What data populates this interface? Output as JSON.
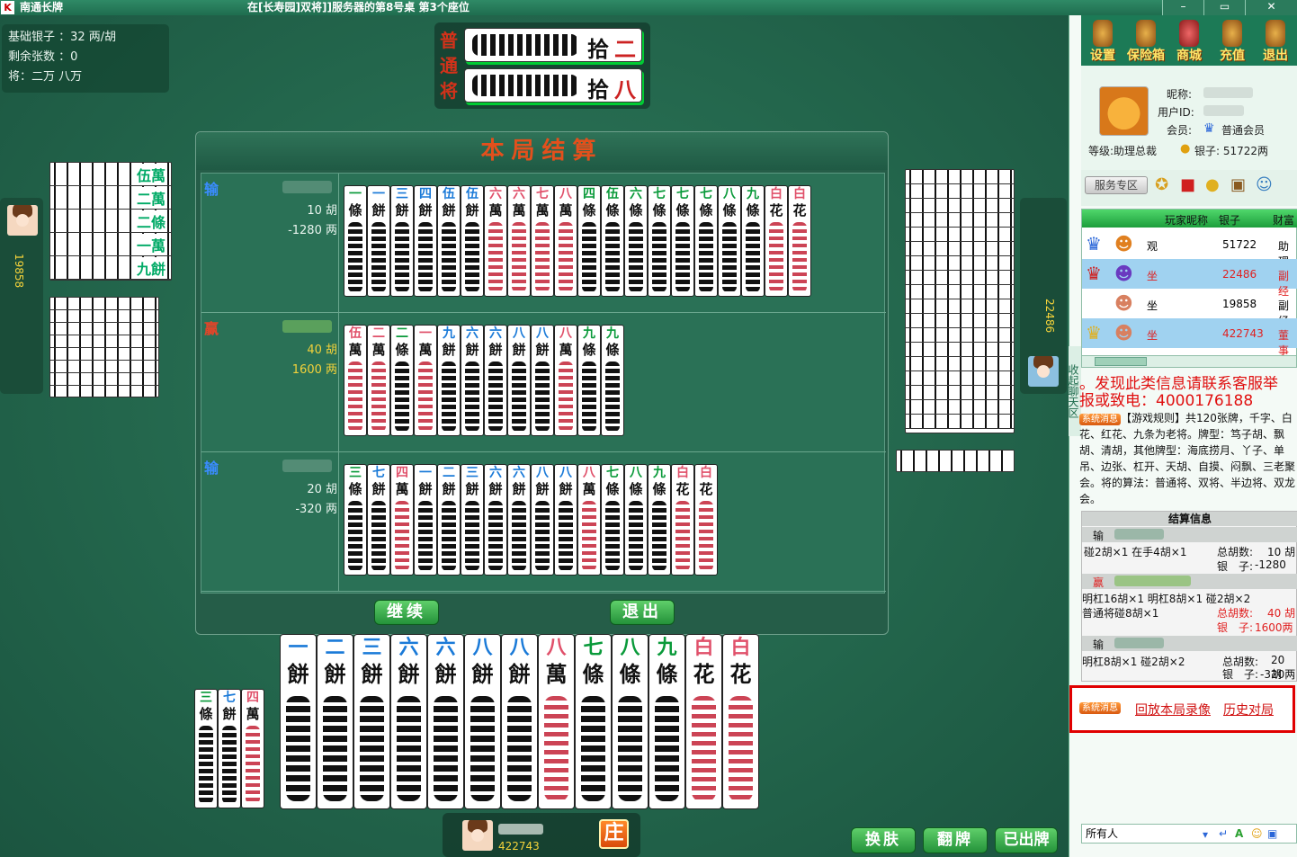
{
  "window": {
    "app_title": "南通长牌",
    "room_title": "在[长寿园]双将]]服务器的第8号桌  第3个座位",
    "controls": [
      "–",
      "▭",
      "✕"
    ]
  },
  "info": {
    "base_silver": "基础银子 ：32 两/胡",
    "remaining": "剩余张数 ：0",
    "jiang": "将：二万 八万"
  },
  "banner": {
    "vertical_text": "普通将",
    "tile1": [
      "二",
      "拾"
    ],
    "tile2": [
      "八",
      "拾"
    ]
  },
  "left_player": {
    "silver": "19858"
  },
  "right_player": {
    "silver": "22486"
  },
  "left_stack": [
    "伍萬",
    "二萬",
    "二條",
    "一萬",
    "九餅"
  ],
  "left_stack2": [
    "九條",
    "九條",
    "九條",
    "九條",
    "九條",
    "九條",
    "九條",
    "九條"
  ],
  "settlement": {
    "title": "本局结算",
    "rows": [
      {
        "result": "输",
        "result_color": "#3a8cff",
        "hu": "10 胡",
        "liang": "-1280 两",
        "tiles": [
          [
            "一",
            "條",
            "g"
          ],
          [
            "一",
            "餅",
            "b"
          ],
          [
            "三",
            "餅",
            "b"
          ],
          [
            "四",
            "餅",
            "b"
          ],
          [
            "伍",
            "餅",
            "b"
          ],
          [
            "伍",
            "餅",
            "b"
          ],
          [
            "六",
            "萬",
            "r"
          ],
          [
            "六",
            "萬",
            "r"
          ],
          [
            "七",
            "萬",
            "r"
          ],
          [
            "八",
            "萬",
            "r"
          ],
          [
            "四",
            "條",
            "g"
          ],
          [
            "伍",
            "條",
            "g"
          ],
          [
            "六",
            "條",
            "g"
          ],
          [
            "七",
            "條",
            "g"
          ],
          [
            "七",
            "條",
            "g"
          ],
          [
            "七",
            "條",
            "g"
          ],
          [
            "八",
            "條",
            "g"
          ],
          [
            "九",
            "條",
            "g"
          ],
          [
            "白",
            "花",
            "r"
          ],
          [
            "白",
            "花",
            "r"
          ]
        ]
      },
      {
        "result": "赢",
        "result_color": "#e0462a",
        "hu": "40 胡",
        "liang": "1600 两",
        "tiles": [
          [
            "伍",
            "萬",
            "r"
          ],
          [
            "二",
            "萬",
            "r"
          ],
          [
            "二",
            "條",
            "g"
          ],
          [
            "一",
            "萬",
            "r"
          ],
          [
            "九",
            "餅",
            "b"
          ],
          [
            "六",
            "餅",
            "b"
          ],
          [
            "六",
            "餅",
            "b"
          ],
          [
            "八",
            "餅",
            "b"
          ],
          [
            "八",
            "餅",
            "b"
          ],
          [
            "八",
            "萬",
            "r"
          ],
          [
            "九",
            "條",
            "g"
          ],
          [
            "九",
            "條",
            "g"
          ]
        ]
      },
      {
        "result": "输",
        "result_color": "#3a8cff",
        "hu": "20 胡",
        "liang": "-320 两",
        "tiles": [
          [
            "三",
            "條",
            "g"
          ],
          [
            "七",
            "餅",
            "b"
          ],
          [
            "四",
            "萬",
            "r"
          ],
          [
            "一",
            "餅",
            "b"
          ],
          [
            "二",
            "餅",
            "b"
          ],
          [
            "三",
            "餅",
            "b"
          ],
          [
            "六",
            "餅",
            "b"
          ],
          [
            "六",
            "餅",
            "b"
          ],
          [
            "八",
            "餅",
            "b"
          ],
          [
            "八",
            "餅",
            "b"
          ],
          [
            "八",
            "萬",
            "r"
          ],
          [
            "七",
            "條",
            "g"
          ],
          [
            "八",
            "條",
            "g"
          ],
          [
            "九",
            "條",
            "g"
          ],
          [
            "白",
            "花",
            "r"
          ],
          [
            "白",
            "花",
            "r"
          ]
        ]
      }
    ],
    "continue_btn": "继续",
    "exit_btn": "退出"
  },
  "hand": [
    [
      "一",
      "餅",
      "b"
    ],
    [
      "二",
      "餅",
      "b"
    ],
    [
      "三",
      "餅",
      "b"
    ],
    [
      "六",
      "餅",
      "b"
    ],
    [
      "六",
      "餅",
      "b"
    ],
    [
      "八",
      "餅",
      "b"
    ],
    [
      "八",
      "餅",
      "b"
    ],
    [
      "八",
      "萬",
      "r"
    ],
    [
      "七",
      "條",
      "g"
    ],
    [
      "八",
      "條",
      "g"
    ],
    [
      "九",
      "條",
      "g"
    ],
    [
      "白",
      "花",
      "r"
    ],
    [
      "白",
      "花",
      "r"
    ]
  ],
  "meld": [
    [
      "三",
      "條",
      "g"
    ],
    [
      "七",
      "餅",
      "b"
    ],
    [
      "四",
      "萬",
      "r"
    ]
  ],
  "self": {
    "silver": "422743",
    "dealer": "庄"
  },
  "game_buttons": [
    "换肤",
    "翻牌",
    "已出牌"
  ],
  "sidebar": {
    "collapse": "收起聊天区",
    "top_icons": [
      "设置",
      "保险箱",
      "商城",
      "充值",
      "退出"
    ],
    "profile": {
      "nickname_label": "昵称:",
      "uid_label": "用户ID:",
      "member_label": "会员:",
      "member_value": "普通会员",
      "level": "等级:助理总裁",
      "silver": "银子: 51722两"
    },
    "service": "服务专区",
    "player_table": {
      "headers": [
        "玩家昵称",
        "银子",
        "财富"
      ],
      "rows": [
        {
          "status": "观",
          "silver": "51722",
          "rank": "助理"
        },
        {
          "status": "坐",
          "silver": "22486",
          "rank": "副经"
        },
        {
          "status": "坐",
          "silver": "19858",
          "rank": "副经"
        },
        {
          "status": "坐",
          "silver": "422743",
          "rank": "董事"
        }
      ]
    },
    "chat": {
      "red1": "。发现此类信息请联系客服举",
      "red2": "报或致电：4000176188",
      "sys_label": "系统消息",
      "rules": "【游戏规则】共120张牌，千字、白花、红花、九条为老将。牌型：笃子胡、飘胡、清胡，其他牌型：海底捞月、丫子、单吊、边张、杠开、天胡、自摸、闷飘、三老聚会。将的算法：普通将、双将、半边将、双龙会。"
    },
    "settle_info": {
      "title": "结算信息",
      "p1_result": "输",
      "p1_detail": "碰2胡×1  在手4胡×1",
      "p1_total": "总胡数:",
      "p1_total_v": "10 胡",
      "p1_silver": "银　子:",
      "p1_silver_v": "-1280两",
      "p2_result": "赢",
      "p2_detail": "明杠16胡×1  明杠8胡×1  碰2胡×2",
      "p2_detail2": "普通将碰8胡×1",
      "p2_total": "总胡数:",
      "p2_total_v": "40 胡",
      "p2_silver": "银　子:",
      "p2_silver_v": "1600两",
      "p3_result": "输",
      "p3_detail": "明杠8胡×1  碰2胡×2",
      "p3_total": "总胡数:",
      "p3_total_v": "20 胡",
      "p3_silver": "银　子:",
      "p3_silver_v": "-320两"
    },
    "replay": {
      "sys": "系统消息",
      "replay_link": "回放本局录像",
      "history_link": "历史对局"
    },
    "input_target": "所有人"
  }
}
